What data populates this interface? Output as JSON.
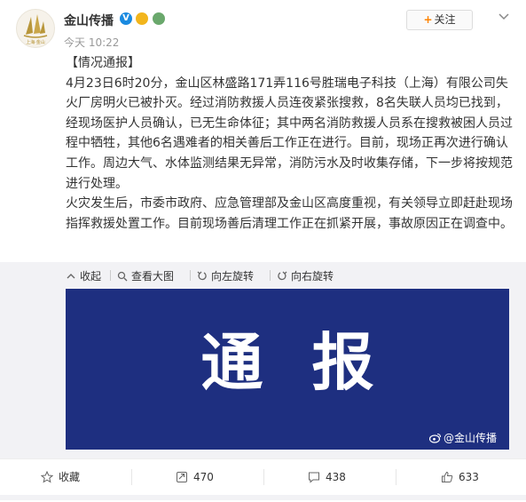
{
  "post": {
    "username": "金山传播",
    "time": "今天 10:22",
    "avatar_text": "上海·金山",
    "follow_label": "关注",
    "follow_plus": "+",
    "paragraphs": [
      "【情况通报】",
      "4月23日6时20分，金山区林盛路171弄116号胜瑞电子科技（上海）有限公司失火厂房明火已被扑灭。经过消防救援人员连夜紧张搜救，8名失联人员均已找到，经现场医护人员确认，已无生命体征；其中两名消防救援人员系在搜救被困人员过程中牺牲，其他6名遇难者的相关善后工作正在进行。目前，现场正再次进行确认工作。周边大气、水体监测结果无异常，消防污水及时收集存储，下一步将按规范进行处理。",
      "火灾发生后，市委市政府、应急管理部及金山区高度重视，有关领导立即赶赴现场指挥救援处置工作。目前现场善后清理工作正在抓紧开展，事故原因正在调查中。"
    ]
  },
  "media": {
    "tools": [
      "收起",
      "查看大图",
      "向左旋转",
      "向右旋转"
    ],
    "image_text": "通报",
    "watermark": "@金山传播",
    "image_color": "#1e2f80"
  },
  "footer": {
    "favorite_label": "收藏",
    "repost_count": "470",
    "comment_count": "438",
    "like_count": "633"
  }
}
